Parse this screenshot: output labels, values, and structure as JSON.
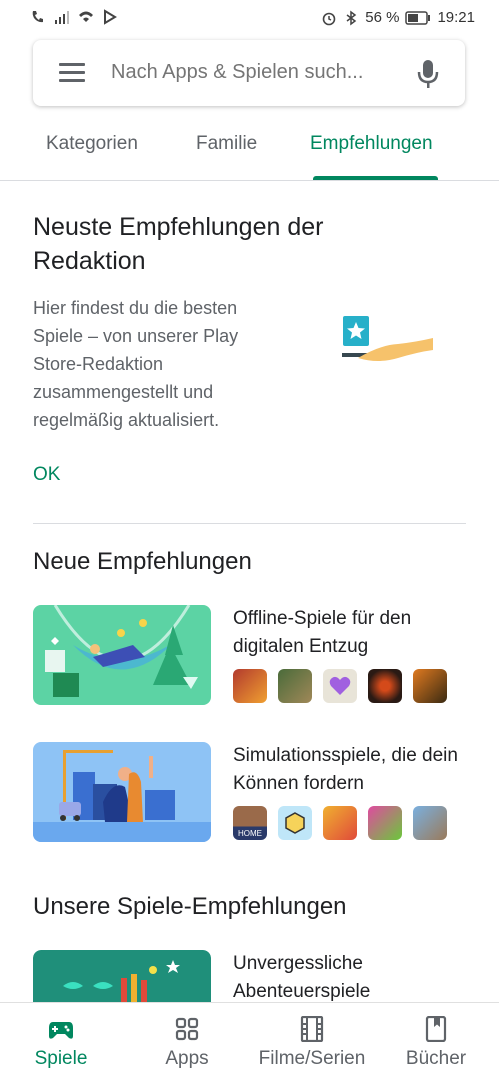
{
  "status_bar": {
    "battery": "56 %",
    "time": "19:21"
  },
  "search": {
    "placeholder": "Nach Apps & Spielen such..."
  },
  "tabs": [
    {
      "label": "Kategorien"
    },
    {
      "label": "Familie"
    },
    {
      "label": "Empfehlungen",
      "active": true
    }
  ],
  "editorial": {
    "title": "Neuste Empfehlungen der Redaktion",
    "text": "Hier findest du die besten Spiele – von unserer Play Store-Redaktion zusammengestellt und regelmäßig aktualisiert.",
    "ok": "OK"
  },
  "sections": {
    "new": "Neue Empfehlungen",
    "ours": "Unsere Spiele-Empfehlungen"
  },
  "collections": [
    {
      "title": "Offline-Spiele für den digitalen Entzug",
      "icons": [
        "#b23a2e",
        "#4a6b3a",
        "#e8e4d8",
        "#2a1a14",
        "#3a2a12"
      ]
    },
    {
      "title": "Simulationsspiele, die dein Können fordern",
      "icon_texts": [
        "HOME"
      ],
      "icons": [
        "#6c4a3a",
        "#3fa0c8",
        "#f0b030",
        "#c83a9a",
        "#9a7a5a"
      ]
    },
    {
      "title": "Unvergessliche Abenteuerspiele"
    }
  ],
  "nav": [
    {
      "label": "Spiele",
      "active": true,
      "icon": "gamepad-icon"
    },
    {
      "label": "Apps",
      "icon": "apps-grid-icon"
    },
    {
      "label": "Filme/Serien",
      "icon": "film-icon"
    },
    {
      "label": "Bücher",
      "icon": "book-icon"
    }
  ],
  "colors": {
    "accent": "#01875f",
    "text": "#202124",
    "muted": "#5f6368"
  }
}
